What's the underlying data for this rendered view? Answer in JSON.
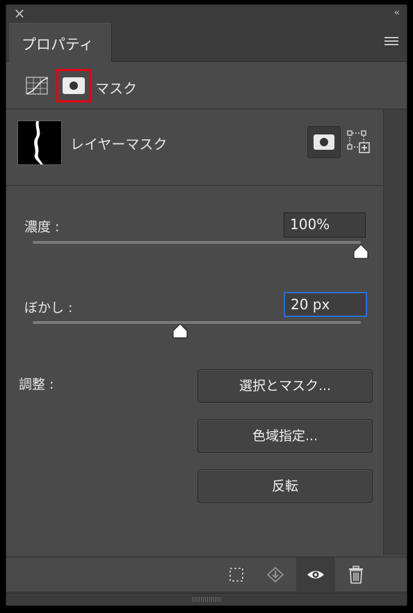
{
  "window": {
    "close_icon": "close-icon",
    "collapse_icon": "double-chevron-left-icon"
  },
  "tab": {
    "label": "プロパティ"
  },
  "mode": {
    "label": "マスク"
  },
  "layer": {
    "name": "レイヤーマスク"
  },
  "density": {
    "label": "濃度 :",
    "value": "100%",
    "slider_fraction": 1.0
  },
  "feather": {
    "label": "ぼかし :",
    "value": "20 px",
    "slider_fraction": 0.45
  },
  "adjust": {
    "label": "調整 :",
    "buttons": [
      "選択とマスク...",
      "色域指定...",
      "反転"
    ]
  },
  "footer": {
    "icons": [
      "selection-icon",
      "apply-mask-icon",
      "eye-icon",
      "trash-icon"
    ]
  },
  "colors": {
    "highlight": "#e60012",
    "focus": "#2a6fd6",
    "panel": "#4a4a4a"
  }
}
